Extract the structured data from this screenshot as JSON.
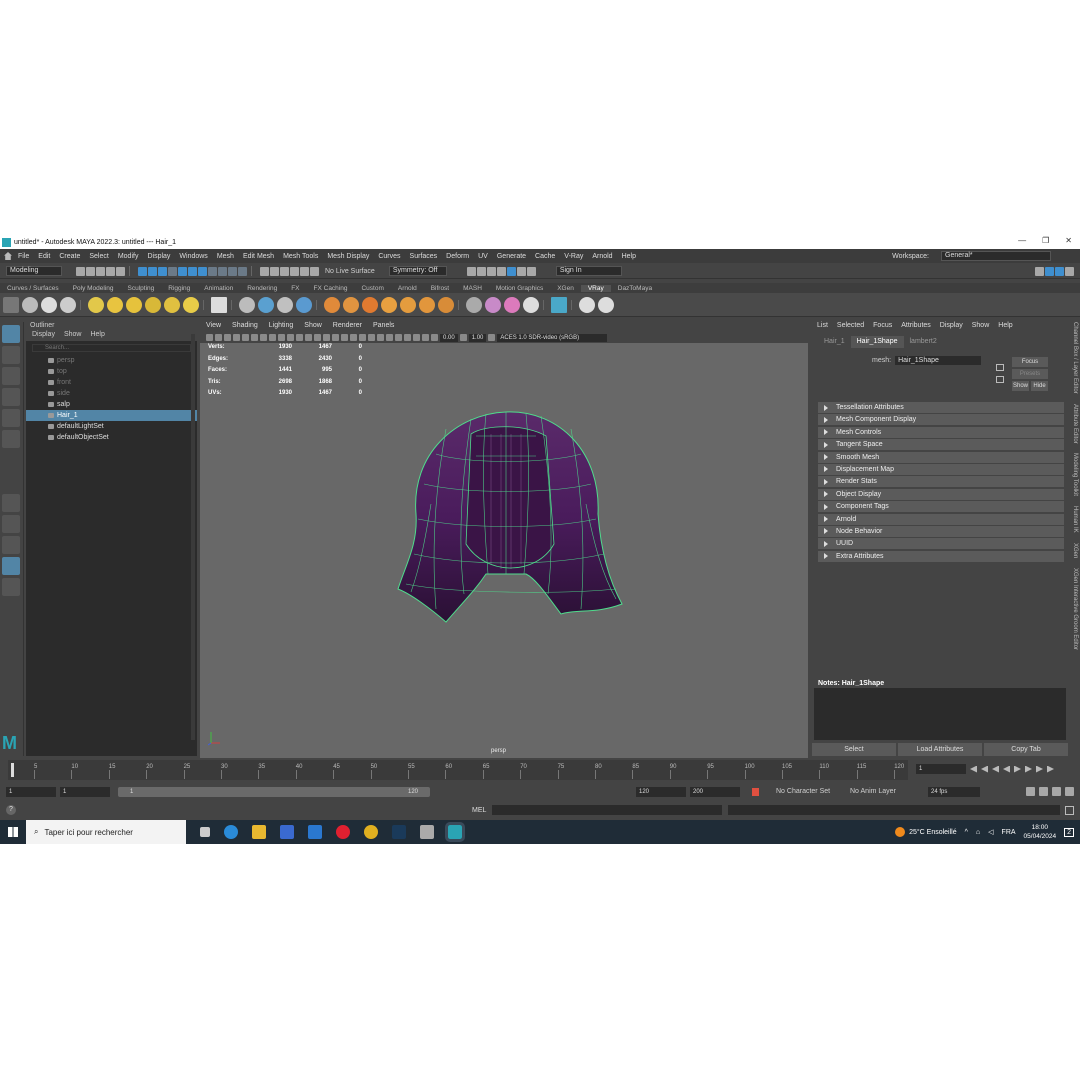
{
  "titlebar": {
    "title": "untitled* - Autodesk MAYA 2022.3: untitled  ---  Hair_1"
  },
  "menubar": {
    "items": [
      "File",
      "Edit",
      "Create",
      "Select",
      "Modify",
      "Display",
      "Windows",
      "Mesh",
      "Edit Mesh",
      "Mesh Tools",
      "Mesh Display",
      "Curves",
      "Surfaces",
      "Deform",
      "UV",
      "Generate",
      "Cache",
      "V-Ray",
      "Arnold",
      "Help"
    ],
    "workspace_label": "Workspace:",
    "workspace_value": "General*"
  },
  "statusline": {
    "mode": "Modeling",
    "live_surface": "No Live Surface",
    "symmetry": "Symmetry: Off",
    "sign_in": "Sign In"
  },
  "shelf_tabs": [
    "Curves / Surfaces",
    "Poly Modeling",
    "Sculpting",
    "Rigging",
    "Animation",
    "Rendering",
    "FX",
    "FX Caching",
    "Custom",
    "Arnold",
    "Bifrost",
    "MASH",
    "Motion Graphics",
    "XGen",
    "VRay",
    "DazToMaya"
  ],
  "shelf_active": "VRay",
  "outliner": {
    "title": "Outliner",
    "menu": [
      "Display",
      "Show",
      "Help"
    ],
    "search_placeholder": "Search...",
    "items": [
      {
        "label": "persp",
        "dim": true
      },
      {
        "label": "top",
        "dim": true
      },
      {
        "label": "front",
        "dim": true
      },
      {
        "label": "side",
        "dim": true
      },
      {
        "label": "salp",
        "dim": false
      },
      {
        "label": "Hair_1",
        "dim": false,
        "selected": true
      },
      {
        "label": "defaultLightSet",
        "dim": false
      },
      {
        "label": "defaultObjectSet",
        "dim": false
      }
    ]
  },
  "viewport": {
    "menu": [
      "View",
      "Shading",
      "Lighting",
      "Show",
      "Renderer",
      "Panels"
    ],
    "exposure": "0.00",
    "gamma": "1.00",
    "color_space": "ACES 1.0 SDR-video (sRGB)",
    "camera": "persp",
    "hud": [
      {
        "label": "Verts:",
        "a": "1930",
        "b": "1467",
        "c": "0"
      },
      {
        "label": "Edges:",
        "a": "3338",
        "b": "2430",
        "c": "0"
      },
      {
        "label": "Faces:",
        "a": "1441",
        "b": "995",
        "c": "0"
      },
      {
        "label": "Tris:",
        "a": "2698",
        "b": "1868",
        "c": "0"
      },
      {
        "label": "UVs:",
        "a": "1930",
        "b": "1467",
        "c": "0"
      }
    ]
  },
  "attribute_editor": {
    "menu": [
      "List",
      "Selected",
      "Focus",
      "Attributes",
      "Display",
      "Show",
      "Help"
    ],
    "tabs": [
      "Hair_1",
      "Hair_1Shape",
      "lambert2"
    ],
    "active_tab": "Hair_1Shape",
    "mesh_label": "mesh:",
    "mesh_value": "Hair_1Shape",
    "focus": "Focus",
    "presets": "Presets",
    "show": "Show",
    "hide": "Hide",
    "sections": [
      "Tessellation Attributes",
      "Mesh Component Display",
      "Mesh Controls",
      "Tangent Space",
      "Smooth Mesh",
      "Displacement Map",
      "Render Stats",
      "Object Display",
      "Component Tags",
      "Arnold",
      "Node Behavior",
      "UUID",
      "Extra Attributes"
    ],
    "notes_label": "Notes: Hair_1Shape",
    "footer": [
      "Select",
      "Load Attributes",
      "Copy Tab"
    ]
  },
  "side_tabs": [
    "Channel Box / Layer Editor",
    "Attribute Editor",
    "Modeling Toolkit",
    "Human IK",
    "XGen",
    "XGen Interactive Groom Editor"
  ],
  "timeline": {
    "ticks": [
      "5",
      "10",
      "15",
      "20",
      "25",
      "30",
      "35",
      "40",
      "45",
      "50",
      "55",
      "60",
      "65",
      "70",
      "75",
      "80",
      "85",
      "90",
      "95",
      "100",
      "105",
      "110",
      "115",
      "120"
    ],
    "current_frame": "1"
  },
  "range": {
    "start": "1",
    "anim_start": "1",
    "slider_start": "1",
    "slider_end": "120",
    "anim_end": "120",
    "end": "200",
    "character_set": "No Character Set",
    "anim_layer": "No Anim Layer",
    "fps": "24 fps"
  },
  "cmdline": {
    "lang": "MEL"
  },
  "taskbar": {
    "search": "Taper ici pour rechercher",
    "weather": "25°C  Ensoleillé",
    "lang": "FRA",
    "time": "18:00",
    "date": "05/04/2024",
    "notifications": "2"
  }
}
